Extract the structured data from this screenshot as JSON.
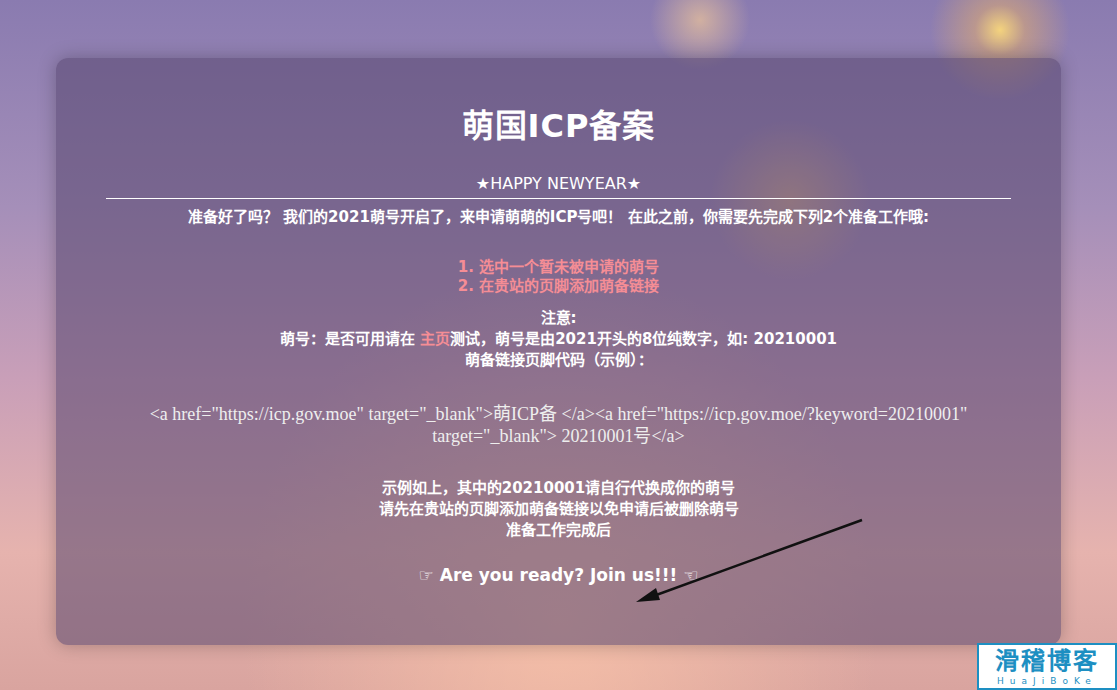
{
  "title": "萌国ICP备案",
  "subtitle": "★HAPPY NEWYEAR★",
  "intro": "准备好了吗？ 我们的2021萌号开启了，来申请萌萌的ICP号吧！ 在此之前，你需要先完成下列2个准备工作哦:",
  "steps": [
    "1. 选中一个暂未被申请的萌号",
    "2. 在贵站的页脚添加萌备链接"
  ],
  "note": {
    "label": "注意:",
    "before_link": "萌号：是否可用请在 ",
    "link": "主页",
    "after_link": "测试，萌号是由2021开头的8位纯数字，如: 20210001",
    "code_label": "萌备链接页脚代码（示例）："
  },
  "code": "<a href=\"https://icp.gov.moe\" target=\"_blank\">萌ICP备 </a><a href=\"https://icp.gov.moe/?keyword=20210001\" target=\"_blank\"> 20210001号</a>",
  "after_lines": [
    "示例如上，其中的20210001请自行代换成你的萌号",
    "请先在贵站的页脚添加萌备链接以免申请后被删除萌号",
    "准备工作完成后"
  ],
  "cta": {
    "left_icon": "☞",
    "label": "Are you ready? Join us!!!",
    "right_icon": "☜"
  },
  "watermark": {
    "title": "滑稽博客",
    "subtitle": "HuaJiBoKe"
  }
}
